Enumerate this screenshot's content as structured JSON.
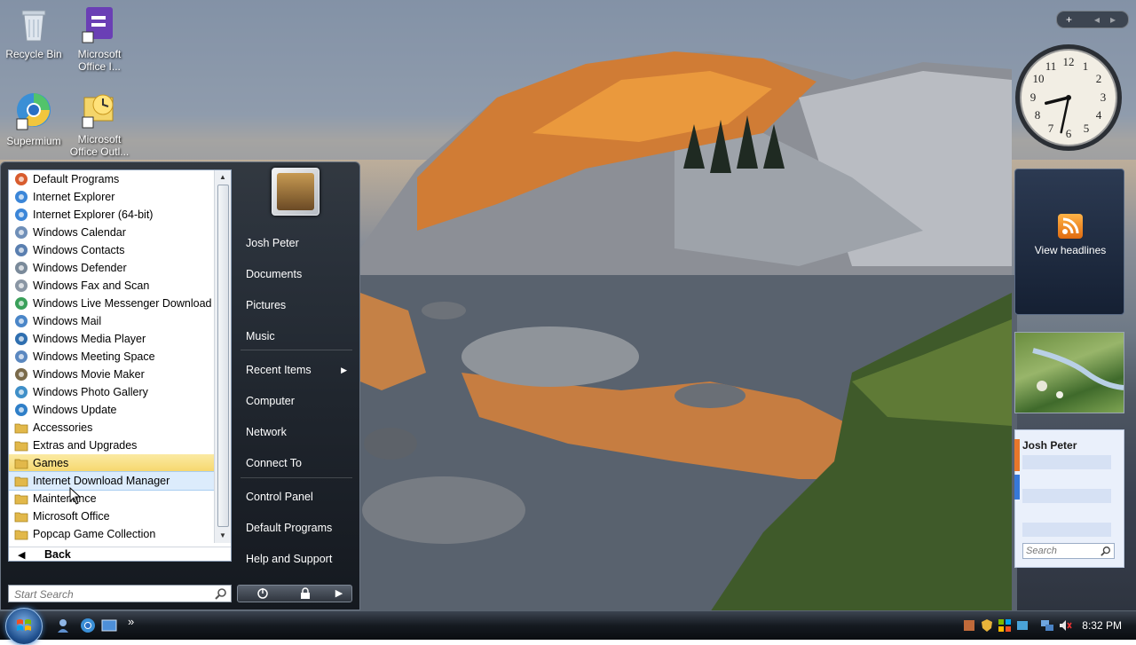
{
  "desktop_icons": [
    {
      "label": "Recycle Bin",
      "icon": "recycle-bin-icon"
    },
    {
      "label": "Microsoft Office I...",
      "icon": "office-install-icon"
    },
    {
      "label": "Supermium",
      "icon": "supermium-browser-icon"
    },
    {
      "label": "Microsoft Office Outl...",
      "icon": "outlook-icon"
    }
  ],
  "start_menu": {
    "programs": [
      {
        "label": "Default Programs",
        "icon": "default-programs-icon"
      },
      {
        "label": "Internet Explorer",
        "icon": "internet-explorer-icon"
      },
      {
        "label": "Internet Explorer (64-bit)",
        "icon": "internet-explorer-icon"
      },
      {
        "label": "Windows Calendar",
        "icon": "calendar-icon"
      },
      {
        "label": "Windows Contacts",
        "icon": "contacts-icon"
      },
      {
        "label": "Windows Defender",
        "icon": "defender-icon"
      },
      {
        "label": "Windows Fax and Scan",
        "icon": "fax-icon"
      },
      {
        "label": "Windows Live Messenger Download",
        "icon": "messenger-icon"
      },
      {
        "label": "Windows Mail",
        "icon": "mail-icon"
      },
      {
        "label": "Windows Media Player",
        "icon": "media-player-icon"
      },
      {
        "label": "Windows Meeting Space",
        "icon": "meeting-space-icon"
      },
      {
        "label": "Windows Movie Maker",
        "icon": "movie-maker-icon"
      },
      {
        "label": "Windows Photo Gallery",
        "icon": "photo-gallery-icon"
      },
      {
        "label": "Windows Update",
        "icon": "windows-update-icon"
      },
      {
        "label": "Accessories",
        "icon": "folder-icon"
      },
      {
        "label": "Extras and Upgrades",
        "icon": "folder-icon"
      },
      {
        "label": "Games",
        "icon": "folder-icon",
        "state": "selected"
      },
      {
        "label": "Internet Download Manager",
        "icon": "folder-icon",
        "state": "hover"
      },
      {
        "label": "Maintenance",
        "icon": "folder-icon"
      },
      {
        "label": "Microsoft Office",
        "icon": "folder-icon"
      },
      {
        "label": "Popcap Game Collection",
        "icon": "folder-icon"
      }
    ],
    "back_label": "Back",
    "search_placeholder": "Start Search",
    "user_name": "Josh Peter",
    "right_items": [
      {
        "label": "Josh Peter"
      },
      {
        "label": "Documents"
      },
      {
        "label": "Pictures"
      },
      {
        "label": "Music"
      },
      {
        "label": "Recent Items",
        "submenu": true
      },
      {
        "label": "Computer"
      },
      {
        "label": "Network"
      },
      {
        "label": "Connect To"
      },
      {
        "label": "Control Panel"
      },
      {
        "label": "Default Programs"
      },
      {
        "label": "Help and Support"
      }
    ]
  },
  "sidebar": {
    "feed_label": "View headlines",
    "notes_user": "Josh Peter",
    "notes_search_placeholder": "Search",
    "clock_time": {
      "hours": 8,
      "minutes": 32
    }
  },
  "taskbar": {
    "clock": "8:32 PM",
    "chevron": "»"
  },
  "colors": {
    "selected_item": "#f6d76c",
    "hover_item": "#dcecfc",
    "start_menu_bg": "#1e242c"
  }
}
